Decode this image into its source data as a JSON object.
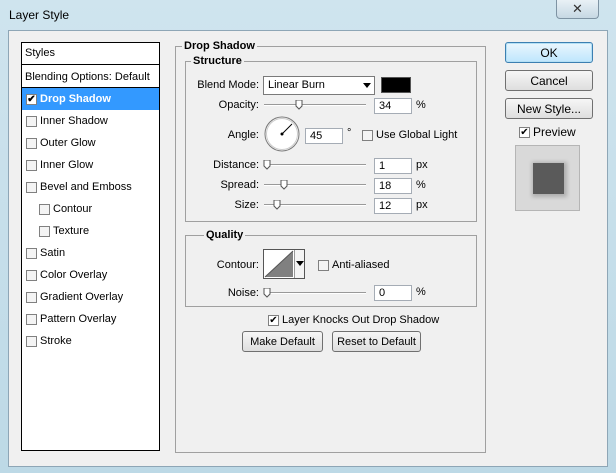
{
  "window": {
    "title": "Layer Style",
    "close_glyph": "✕"
  },
  "styles_panel": {
    "header": "Styles",
    "blending": "Blending Options: Default",
    "items": [
      {
        "label": "Drop Shadow",
        "checked": true,
        "selected": true
      },
      {
        "label": "Inner Shadow",
        "checked": false
      },
      {
        "label": "Outer Glow",
        "checked": false
      },
      {
        "label": "Inner Glow",
        "checked": false
      },
      {
        "label": "Bevel and Emboss",
        "checked": false
      },
      {
        "label": "Contour",
        "checked": false,
        "indent": true
      },
      {
        "label": "Texture",
        "checked": false,
        "indent": true
      },
      {
        "label": "Satin",
        "checked": false
      },
      {
        "label": "Color Overlay",
        "checked": false
      },
      {
        "label": "Gradient Overlay",
        "checked": false
      },
      {
        "label": "Pattern Overlay",
        "checked": false
      },
      {
        "label": "Stroke",
        "checked": false
      }
    ]
  },
  "drop_shadow": {
    "title": "Drop Shadow",
    "structure": {
      "title": "Structure",
      "blend_mode_label": "Blend Mode:",
      "blend_mode_value": "Linear Burn",
      "shadow_color": "#000000",
      "opacity_label": "Opacity:",
      "opacity_value": "34",
      "opacity_unit": "%",
      "angle_label": "Angle:",
      "angle_value": "45",
      "angle_unit": "°",
      "global_light_label": "Use Global Light",
      "global_light_checked": false,
      "distance_label": "Distance:",
      "distance_value": "1",
      "distance_unit": "px",
      "spread_label": "Spread:",
      "spread_value": "18",
      "spread_unit": "%",
      "size_label": "Size:",
      "size_value": "12",
      "size_unit": "px"
    },
    "quality": {
      "title": "Quality",
      "contour_label": "Contour:",
      "anti_aliased_label": "Anti-aliased",
      "anti_aliased_checked": false,
      "noise_label": "Noise:",
      "noise_value": "0",
      "noise_unit": "%"
    },
    "knockout_label": "Layer Knocks Out Drop Shadow",
    "knockout_checked": true,
    "make_default": "Make Default",
    "reset_default": "Reset to Default"
  },
  "buttons": {
    "ok": "OK",
    "cancel": "Cancel",
    "new_style": "New Style...",
    "preview_label": "Preview",
    "preview_checked": true
  },
  "colors": {
    "selection": "#3399ff",
    "preview_swatch": "#5a5a5a"
  }
}
